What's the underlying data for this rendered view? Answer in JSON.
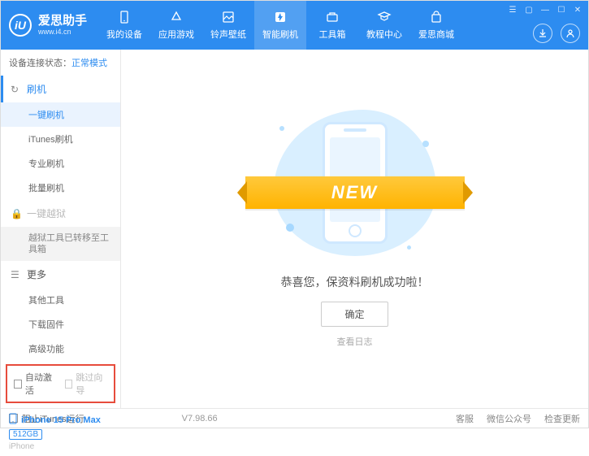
{
  "header": {
    "logo_title": "爱思助手",
    "logo_sub": "www.i4.cn",
    "nav": [
      {
        "label": "我的设备"
      },
      {
        "label": "应用游戏"
      },
      {
        "label": "铃声壁纸"
      },
      {
        "label": "智能刷机"
      },
      {
        "label": "工具箱"
      },
      {
        "label": "教程中心"
      },
      {
        "label": "爱思商城"
      }
    ]
  },
  "sidebar": {
    "status_label": "设备连接状态：",
    "status_value": "正常模式",
    "group_flash": "刷机",
    "items_flash": [
      "一键刷机",
      "iTunes刷机",
      "专业刷机",
      "批量刷机"
    ],
    "group_jailbreak": "一键越狱",
    "jailbreak_note": "越狱工具已转移至工具箱",
    "group_more": "更多",
    "items_more": [
      "其他工具",
      "下载固件",
      "高级功能"
    ],
    "checkbox1": "自动激活",
    "checkbox2": "跳过向导",
    "device_name": "iPhone 15 Pro Max",
    "device_storage": "512GB",
    "device_type": "iPhone"
  },
  "main": {
    "ribbon": "NEW",
    "success": "恭喜您，保资料刷机成功啦！",
    "confirm": "确定",
    "view_log": "查看日志"
  },
  "footer": {
    "block_itunes": "阻止iTunes运行",
    "version": "V7.98.66",
    "links": [
      "客服",
      "微信公众号",
      "检查更新"
    ]
  }
}
